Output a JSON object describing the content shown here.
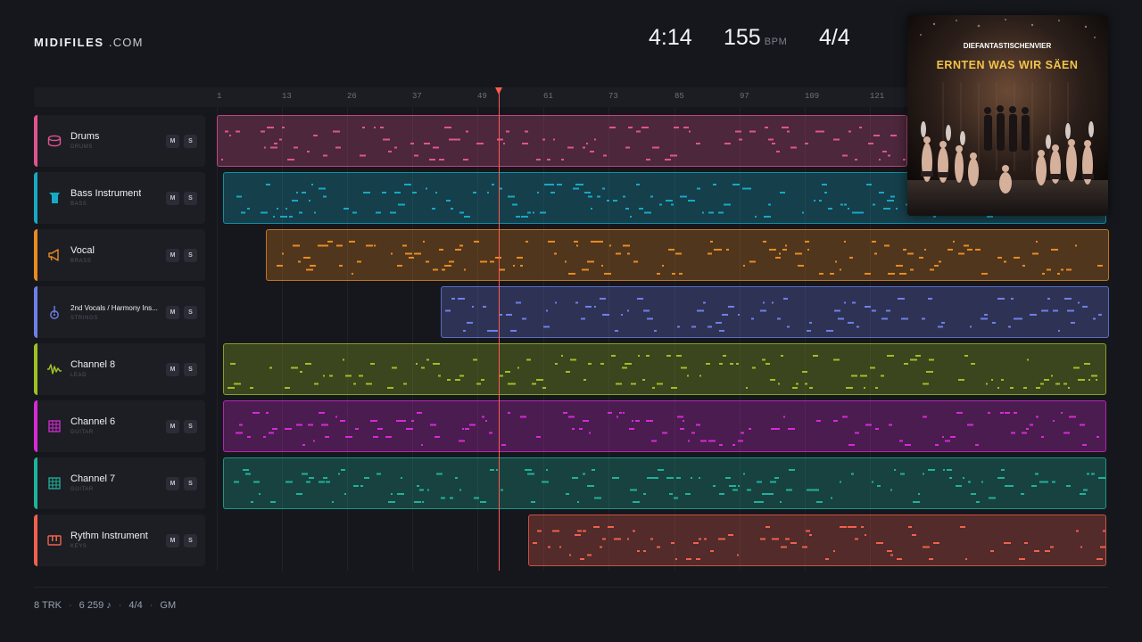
{
  "brand": {
    "name": "MIDIFILES",
    "suffix": ".COM"
  },
  "header": {
    "duration": "4:14",
    "tempo": "155",
    "tempo_unit": "BPM",
    "time_signature": "4/4"
  },
  "ruler": {
    "ticks": [
      "1",
      "13",
      "26",
      "37",
      "49",
      "61",
      "73",
      "85",
      "97",
      "109",
      "121"
    ]
  },
  "tracks": [
    {
      "name": "Drums",
      "sub": "DRUMS",
      "color": "#e0548e",
      "icon": "drum-icon",
      "mute": "M",
      "solo": "S"
    },
    {
      "name": "Bass Instrument",
      "sub": "BASS",
      "color": "#17a9c4",
      "icon": "bass-icon",
      "mute": "M",
      "solo": "S"
    },
    {
      "name": "Vocal",
      "sub": "BRASS",
      "color": "#e98a22",
      "icon": "horn-icon",
      "mute": "M",
      "solo": "S"
    },
    {
      "name": "2nd Vocals / Harmony Ins...",
      "sub": "STRINGS",
      "color": "#6f7fe8",
      "icon": "guitar-icon",
      "mute": "M",
      "solo": "S"
    },
    {
      "name": "Channel 8",
      "sub": "LEAD",
      "color": "#9dc024",
      "icon": "waveform-icon",
      "mute": "M",
      "solo": "S"
    },
    {
      "name": "Channel 6",
      "sub": "GUITAR",
      "color": "#d62ad6",
      "icon": "fretboard-icon",
      "mute": "M",
      "solo": "S"
    },
    {
      "name": "Channel 7",
      "sub": "GUITAR",
      "color": "#1fb29c",
      "icon": "fretboard-icon",
      "mute": "M",
      "solo": "S"
    },
    {
      "name": "Rythm Instrument",
      "sub": "KEYS",
      "color": "#f0614e",
      "icon": "keys-icon",
      "mute": "M",
      "solo": "S"
    }
  ],
  "album": {
    "artist": "DIEFANTASTISCHENVIER",
    "title": "ERNTEN WAS WIR SÄEN"
  },
  "footer": {
    "tracks": "8 TRK",
    "notes": "6 259 ♪",
    "signature": "4/4",
    "standard": "GM"
  }
}
